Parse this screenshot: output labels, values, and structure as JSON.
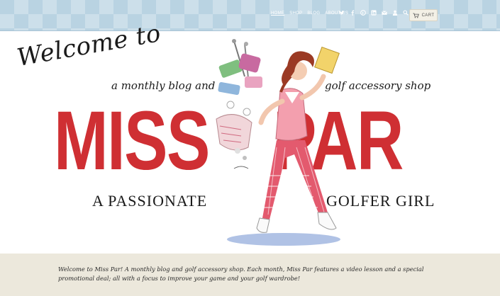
{
  "nav": {
    "items": [
      {
        "label": "HOME",
        "active": true
      },
      {
        "label": "SHOP",
        "active": false
      },
      {
        "label": "BLOG",
        "active": false
      },
      {
        "label": "ABOUT US",
        "active": false
      }
    ],
    "icons": [
      "twitter-icon",
      "facebook-icon",
      "pinterest-icon",
      "linkedin-icon",
      "email-icon",
      "account-icon",
      "search-icon"
    ],
    "cart_label": "CART"
  },
  "hero": {
    "welcome": "Welcome to",
    "subline_left": "a monthly blog and",
    "subline_right": "golf accessory shop",
    "title_left": "MISS",
    "title_right": "PAR",
    "tagline_left": "A PASSIONATE",
    "tagline_right": "GOLFER GIRL"
  },
  "intro": {
    "text": "Welcome to Miss Par! A monthly blog and golf accessory shop. Each month, Miss Par features a video lesson and a special promotional deal; all with a focus to improve your game and your golf wardrobe!"
  },
  "colors": {
    "header_bg": "#b9d3e2",
    "title_red": "#cf2f33",
    "band_bg": "#ece8dc"
  }
}
